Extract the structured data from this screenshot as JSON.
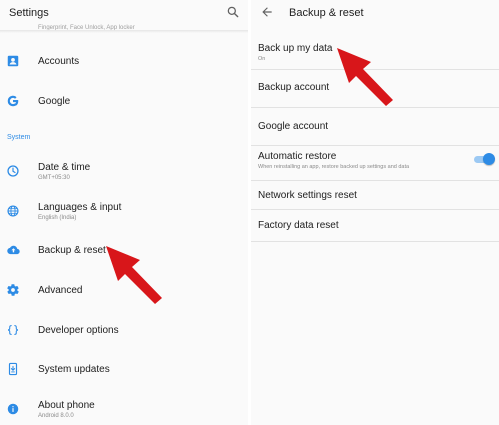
{
  "settings_panel": {
    "title": "Settings",
    "cut_off_text": "Fingerprint, Face Unlock, App locker",
    "items_top": [
      {
        "label": "Accounts",
        "icon": "account-box-icon"
      },
      {
        "label": "Google",
        "icon": "google-icon"
      }
    ],
    "section_header": "System",
    "items_system": [
      {
        "label": "Date & time",
        "sub": "GMT+05:30",
        "icon": "clock-icon"
      },
      {
        "label": "Languages & input",
        "sub": "English (India)",
        "icon": "globe-icon"
      },
      {
        "label": "Backup & reset",
        "icon": "cloud-upload-icon"
      },
      {
        "label": "Advanced",
        "icon": "gear-icon"
      },
      {
        "label": "Developer options",
        "icon": "code-braces-icon"
      },
      {
        "label": "System updates",
        "icon": "phone-update-icon"
      },
      {
        "label": "About phone",
        "sub": "Android 8.0.0",
        "icon": "info-icon"
      }
    ]
  },
  "backup_panel": {
    "title": "Backup & reset",
    "items": [
      {
        "label": "Back up my data",
        "sub": "On"
      },
      {
        "label": "Backup account"
      },
      {
        "label": "Google account"
      },
      {
        "label": "Automatic restore",
        "sub": "When reinstalling an app, restore backed up settings and data",
        "toggle_on": true
      },
      {
        "label": "Network settings reset"
      },
      {
        "label": "Factory data reset"
      }
    ]
  },
  "colors": {
    "accent": "#2d8be5",
    "icon": "#2d8be5",
    "arrow": "#d8161a",
    "background": "#fafafa"
  }
}
